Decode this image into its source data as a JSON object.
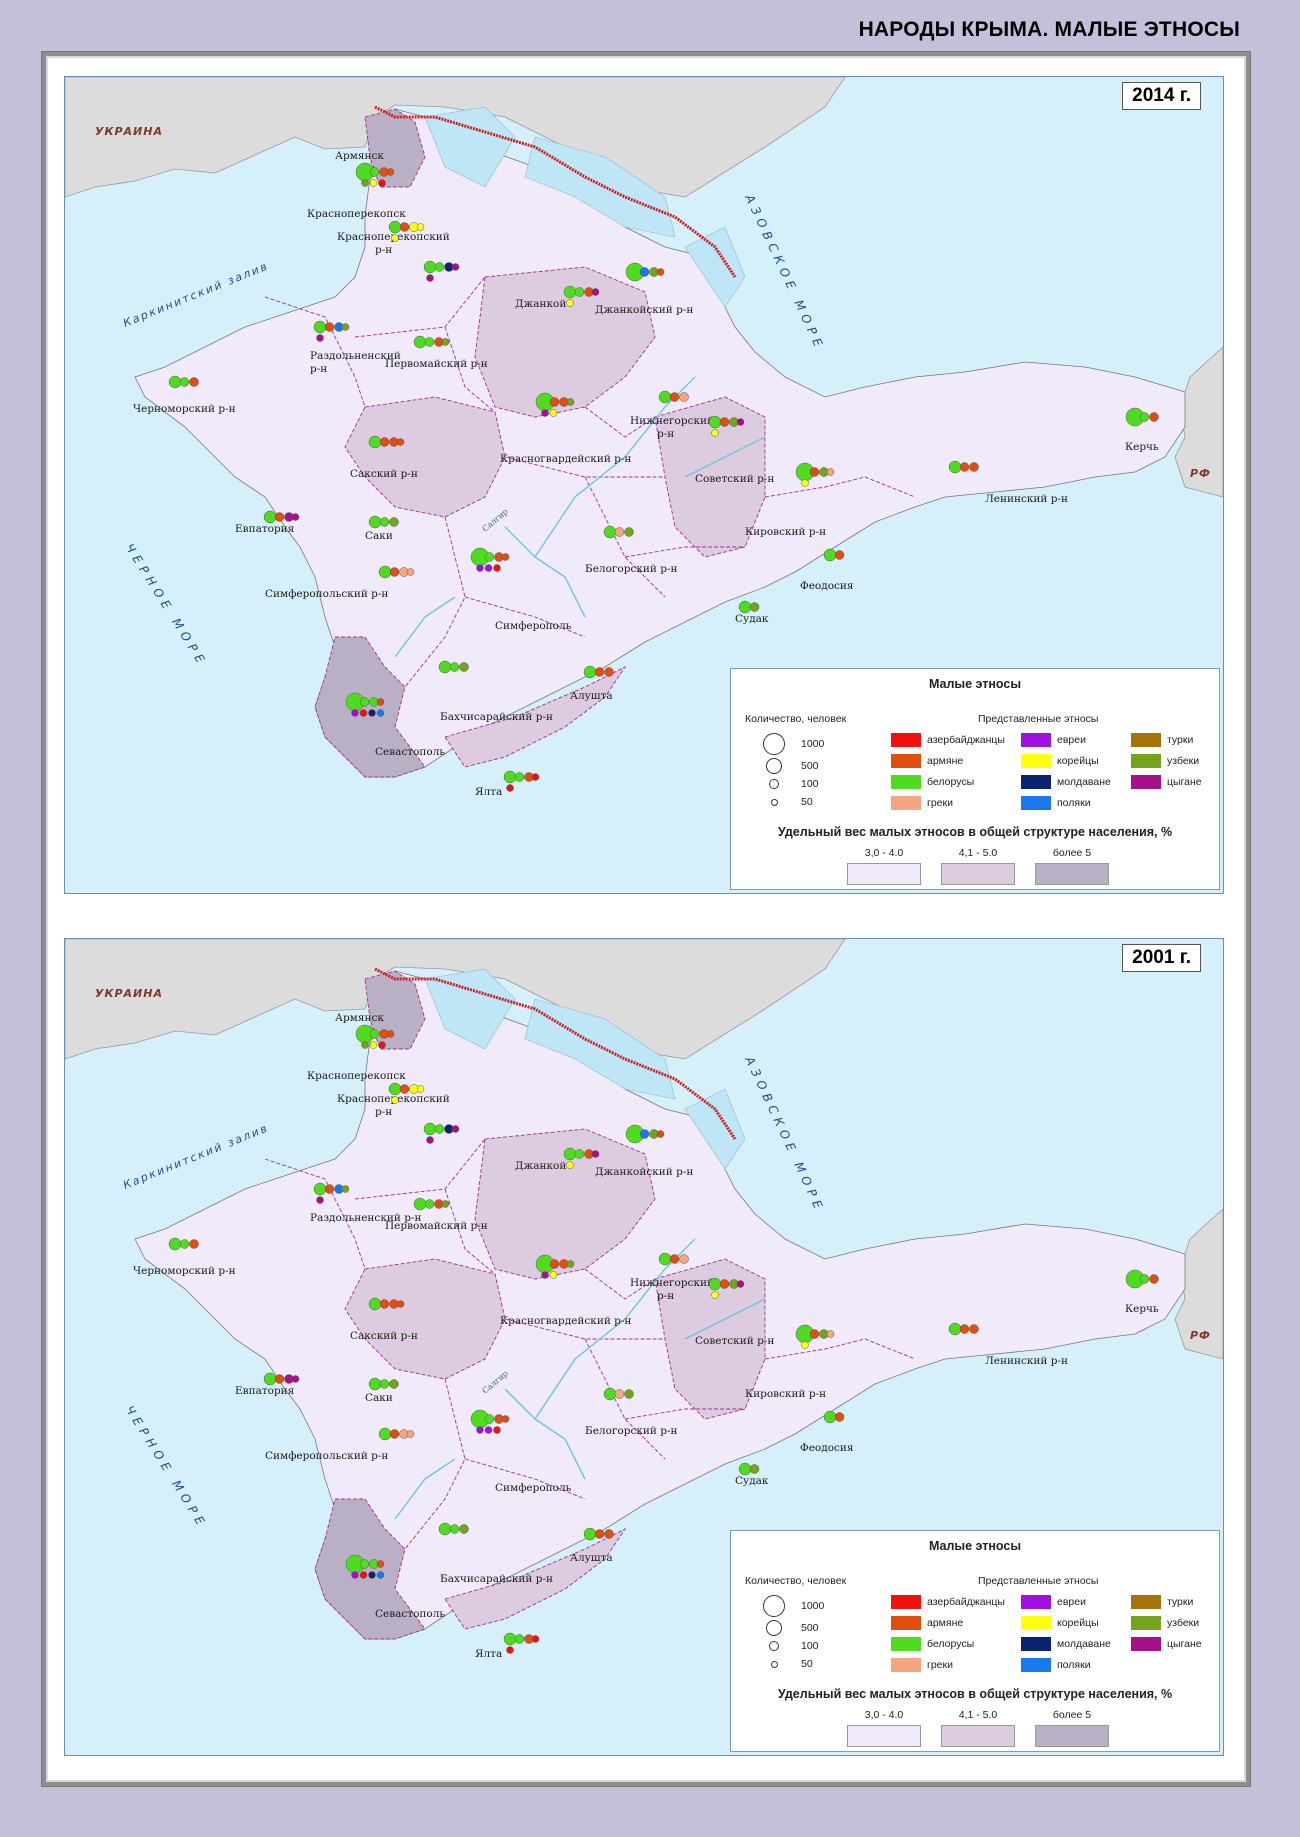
{
  "title": "НАРОДЫ КРЫМА. МАЛЫЕ ЭТНОСЫ",
  "colors": {
    "azerbaijanis": "#f01010",
    "armenians": "#e04e10",
    "belarusians": "#4fdc20",
    "greeks": "#f4a582",
    "jews": "#a010e0",
    "koreans": "#ffff10",
    "moldovans": "#0a2372",
    "poles": "#1a78ee",
    "turks": "#a8720a",
    "uzbeks": "#74a41a",
    "roma": "#a8108a",
    "share_low": "#f1eafa",
    "share_mid": "#ddcbe0",
    "share_high": "#bab0c6",
    "sea": "#d6f0fb",
    "neighbor_land": "#dcdcdc",
    "border_line": "#cc2020"
  },
  "maps": [
    {
      "year": "2014 г.",
      "labels": {
        "ukraine": "УКРАИНА",
        "rf": "РФ",
        "black_sea": "ЧЕРНОЕ МОРЕ",
        "azov_sea": "АЗОВСКОЕ МОРЕ",
        "gulf": "Каркинитский залив",
        "river": "Салгир",
        "armyansk": "Армянск",
        "krasnoperekopsk": "Красноперекопск",
        "krasnoperekopsky_line1": "Красноперекопский",
        "krasnoperekopsky_line2": "р-н",
        "dzhankoy": "Джанкой",
        "dzhankoysky": "Джанкойский р-н",
        "razdolnensky_line1": "Раздольненский",
        "razdolnensky_line2": "р-н",
        "pervomaysky": "Первомайский р-н",
        "chernomorsky": "Черноморский р-н",
        "nizhnegorsky_line1": "Нижнегорский",
        "nizhnegorsky_line2": "р-н",
        "krasnogvardeysky": "Красногвардейский р-н",
        "saksky": "Сакский р-н",
        "sovetsky": "Советский р-н",
        "kerch": "Керчь",
        "leninsky": "Ленинский р-н",
        "evpatoria": "Евпатория",
        "saki": "Саки",
        "kirovsky": "Кировский р-н",
        "belogorsky": "Белогорский р-н",
        "feodosia": "Феодосия",
        "simferopolsky": "Симферопольский р-н",
        "simferopol": "Симферополь",
        "sudak": "Судак",
        "alushta": "Алушта",
        "bakhchisaraysky": "Бахчисарайский р-н",
        "sevastopol": "Севастополь",
        "yalta": "Ялта"
      }
    },
    {
      "year": "2001 г.",
      "labels": {
        "ukraine": "УКРАИНА",
        "rf": "РФ",
        "black_sea": "ЧЕРНОЕ МОРЕ",
        "azov_sea": "АЗОВСКОЕ МОРЕ",
        "gulf": "Каркинитский залив",
        "river": "Салгир",
        "armyansk": "Армянск",
        "krasnoperekopsk": "Красноперекопск",
        "krasnoperekopsky_line1": "Красноперекопский",
        "krasnoperekopsky_line2": "р-н",
        "dzhankoy": "Джанкой",
        "dzhankoysky": "Джанкойский р-н",
        "razdolnensky_line1": "Раздольненский р-н",
        "razdolnensky_line2": "",
        "pervomaysky": "Первомайский р-н",
        "chernomorsky": "Черноморский р-н",
        "nizhnegorsky_line1": "Нижнегорский",
        "nizhnegorsky_line2": "р-н",
        "krasnogvardeysky": "Красногвардейский р-н",
        "saksky": "Сакский р-н",
        "sovetsky": "Советский р-н",
        "kerch": "Керчь",
        "leninsky": "Ленинский р-н",
        "evpatoria": "Евпатория",
        "saki": "Саки",
        "kirovsky": "Кировский р-н",
        "belogorsky": "Белогорский р-н",
        "feodosia": "Феодосия",
        "simferopolsky": "Симферопольский р-н",
        "simferopol": "Симферополь",
        "sudak": "Судак",
        "alushta": "Алушта",
        "bakhchisaraysky": "Бахчисарайский р-н",
        "sevastopol": "Севастополь",
        "yalta": "Ялта"
      }
    }
  ],
  "legend": {
    "title": "Малые этносы",
    "quantity_header": "Количество, человек",
    "ethnos_header": "Представленные этносы",
    "sizes": [
      "1000",
      "500",
      "100",
      "50"
    ],
    "ethnos": [
      {
        "label": "азербайджанцы",
        "color": "#f01010"
      },
      {
        "label": "евреи",
        "color": "#a010e0"
      },
      {
        "label": "турки",
        "color": "#a8720a"
      },
      {
        "label": "армяне",
        "color": "#e04e10"
      },
      {
        "label": "корейцы",
        "color": "#ffff10"
      },
      {
        "label": "узбеки",
        "color": "#74a41a"
      },
      {
        "label": "белорусы",
        "color": "#4fdc20"
      },
      {
        "label": "молдаване",
        "color": "#0a2372"
      },
      {
        "label": "цыгане",
        "color": "#a8108a"
      },
      {
        "label": "греки",
        "color": "#f4a582"
      },
      {
        "label": "поляки",
        "color": "#1a78ee"
      }
    ],
    "share_title": "Удельный вес малых этносов  в общей структуре населения, %",
    "share_classes": [
      {
        "label": "3,0 - 4.0",
        "color": "#f1eafa"
      },
      {
        "label": "4,1 - 5.0",
        "color": "#ddcbe0"
      },
      {
        "label": "более 5",
        "color": "#bab0c6"
      }
    ]
  }
}
